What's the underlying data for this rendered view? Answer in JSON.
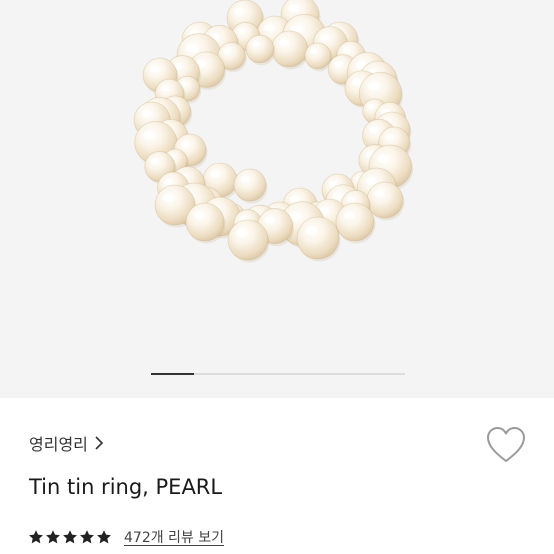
{
  "product": {
    "brand_label": "영리영리",
    "title": "Tin tin ring, PEARL",
    "image_alt": "Pearl beaded ring"
  },
  "gallery": {
    "current_page_fraction": 0.17
  },
  "rating": {
    "stars": 5,
    "max_stars": 5,
    "review_link": "472개 리뷰 보기"
  },
  "icons": {
    "brand_chevron": "chevron-right-icon",
    "wishlist": "heart-outline-icon",
    "rating_star": "star-icon"
  },
  "colors": {
    "image_bg": "#f4f4f4",
    "pearl": "#f6efe2",
    "text": "#1a1a1a",
    "star": "#222222"
  }
}
